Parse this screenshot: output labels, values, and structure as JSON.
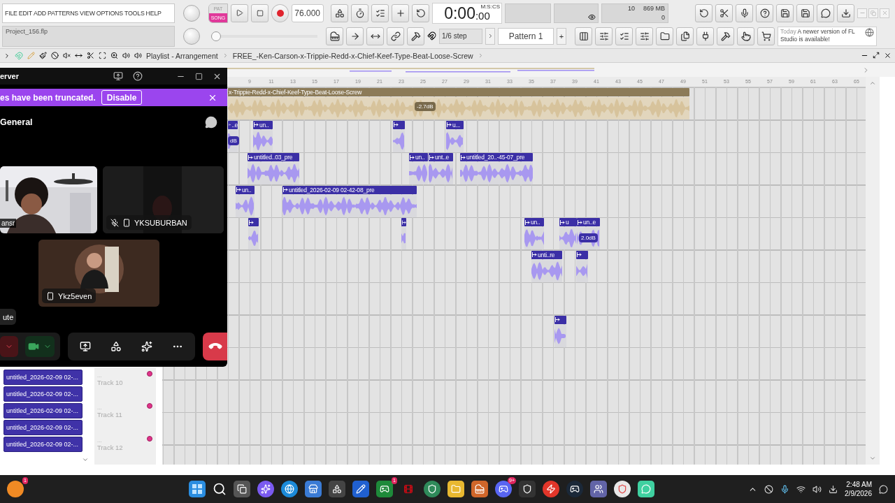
{
  "menu": [
    "FILE",
    "EDIT",
    "ADD",
    "PATTERNS",
    "VIEW",
    "OPTIONS",
    "TOOLS",
    "HELP"
  ],
  "transport": {
    "modes": [
      {
        "label": "PAT",
        "selected": false
      },
      {
        "label": "SONG",
        "selected": true
      }
    ],
    "tempo": "76.000"
  },
  "time": {
    "main": "0:00",
    "sub": ":00",
    "units": "M:S:CS"
  },
  "monitor": {
    "voices": "10",
    "memory": "869 MB",
    "polyphony": "0"
  },
  "project": "Project_156.flp",
  "pitch_slider": {
    "level": 0
  },
  "snap": "1/6 step",
  "pattern": {
    "name": "Pattern 1",
    "add": "+"
  },
  "news": {
    "when": "Today",
    "text": "A newer version of FL Studio is available!"
  },
  "playlist": {
    "title": "Playlist - Arrangement",
    "song": "FREE_-Ken-Carson-x-Trippie-Redd-x-Chief-Keef-Type-Beat-Loose-Screw",
    "bars": [
      "9",
      "11",
      "13",
      "15",
      "17",
      "19",
      "21",
      "23",
      "25",
      "27",
      "29",
      "31",
      "33",
      "35",
      "37",
      "39",
      "41",
      "43",
      "45",
      "47",
      "49",
      "51",
      "53",
      "55",
      "57",
      "59",
      "61",
      "63",
      "65"
    ],
    "clips": [
      {
        "label": "x-Trippie-Redd-x-Chief-Keef-Type-Beat-Loose-Screw",
        "badge": "-2.7dB",
        "color": "#8c7b58"
      },
      {
        "label": "..e",
        "badge": "dB",
        "color": "#3b2fa6"
      },
      {
        "label": "un..",
        "color": "#3b2fa6"
      },
      {
        "color": "#3b2fa6"
      },
      {
        "label": "u...",
        "color": "#3b2fa6"
      },
      {
        "label": "untitled..03_pre",
        "color": "#3b2fa6"
      },
      {
        "label": "un..",
        "color": "#3b2fa6"
      },
      {
        "label": "unt..e",
        "color": "#3b2fa6"
      },
      {
        "label": "untitled_20..-45-07_pre",
        "color": "#3b2fa6"
      },
      {
        "label": "un..",
        "color": "#3b2fa6"
      },
      {
        "label": "untitled_2026-02-09 02-42-08_pre",
        "color": "#3b2fa6"
      },
      {
        "color": "#3b2fa6"
      },
      {
        "color": "#3b2fa6"
      },
      {
        "label": "un..",
        "color": "#3b2fa6"
      },
      {
        "label": "u",
        "color": "#3b2fa6"
      },
      {
        "label": "un..e",
        "badge": "2.0dB",
        "color": "#3b2fa6"
      },
      {
        "label": "unti..re",
        "color": "#3b2fa6"
      },
      {
        "color": "#3b2fa6"
      },
      {
        "color": "#3b2fa6"
      }
    ],
    "tracks": [
      {
        "dots": "...",
        "name": "Track 10"
      },
      {
        "dots": "...",
        "name": "Track 11"
      },
      {
        "dots": "...",
        "name": "Track 12"
      }
    ],
    "pattern_list": [
      "untitled_2026-02-09 02-...",
      "untitled_2026-02-09 02-...",
      "untitled_2026-02-09 02-...",
      "untitled_2026-02-09 02-...",
      "untitled_2026-02-09 02-..."
    ]
  },
  "discord": {
    "title": "erver",
    "banner": {
      "text": "es have been truncated.",
      "action": "Disable"
    },
    "channel": "General",
    "participants": [
      {
        "name": "ansr",
        "kind": "video"
      },
      {
        "name": "YKSUBURBAN",
        "kind": "dark",
        "muted": true
      },
      {
        "name": "Ykz5even",
        "kind": "avatar"
      }
    ],
    "side_button": "ute",
    "mic_muted": true,
    "camera_on": true
  },
  "taskbar": {
    "start_badge": "1",
    "xbox_badge": "1",
    "discord_badge": "9+",
    "time": "2:48 AM",
    "date": "2/9/2026"
  }
}
